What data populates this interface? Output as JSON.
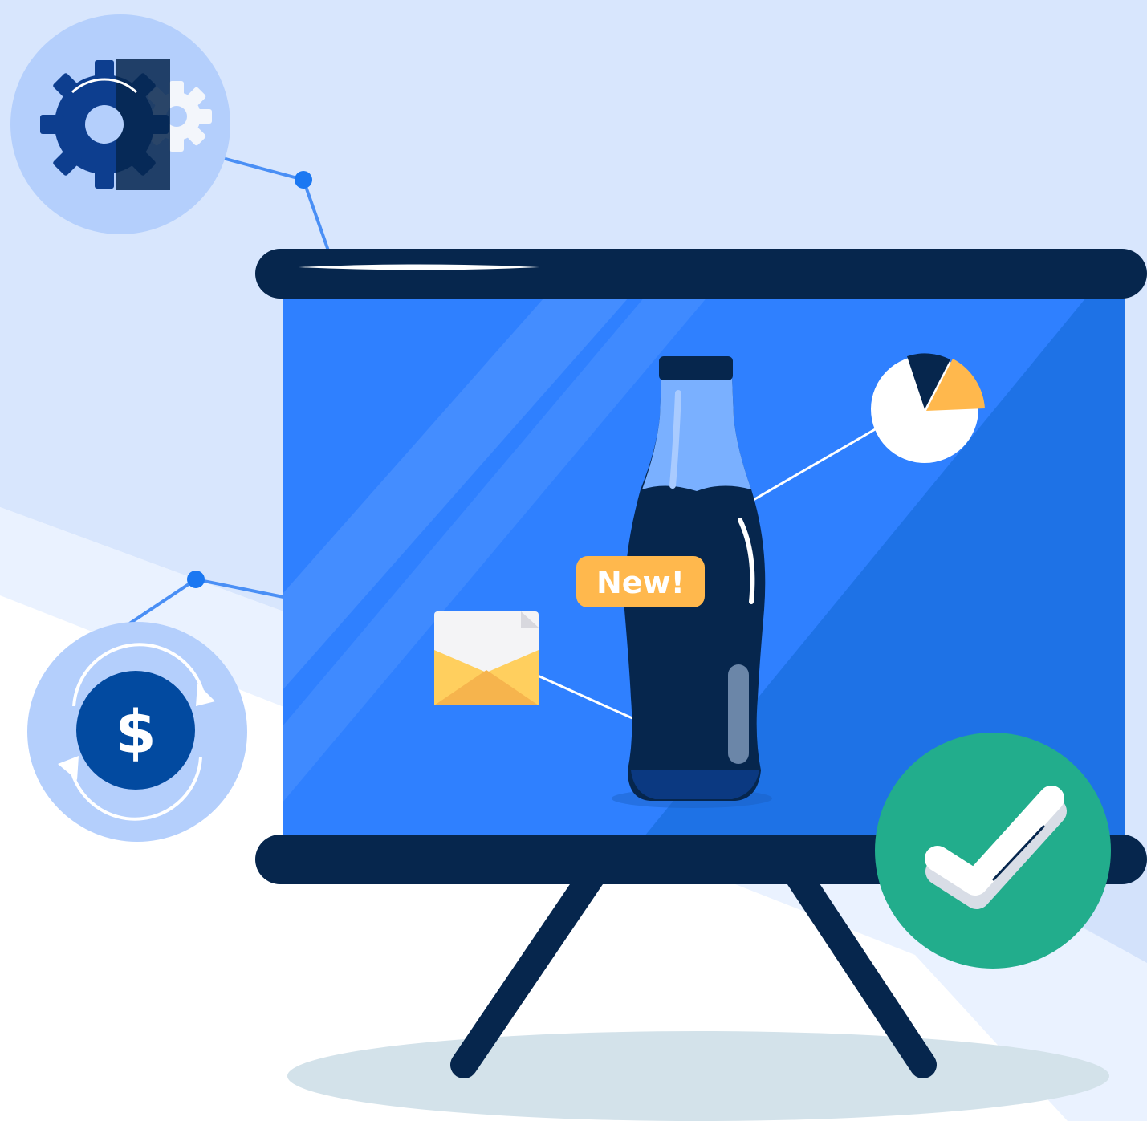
{
  "badge": {
    "label": "New!"
  },
  "currency_icon": {
    "symbol": "$"
  },
  "icons": [
    "gears-icon",
    "pie-chart-icon",
    "envelope-icon",
    "bottle-icon",
    "dollar-exchange-icon",
    "check-icon",
    "presentation-board-icon"
  ],
  "colors": {
    "background_light": "#d8e6fd",
    "background_pale": "#eaf2ff",
    "screen_blue": "#2f80ff",
    "screen_blue_dark": "#1e72e6",
    "frame_navy": "#06264d",
    "icon_circle": "#b4cffc",
    "accent_orange": "#ffb84d",
    "accent_green": "#22ad8c",
    "connector_blue": "#4a8ff5",
    "node_blue": "#1b78f2",
    "shadow": "#d3e2ea"
  }
}
